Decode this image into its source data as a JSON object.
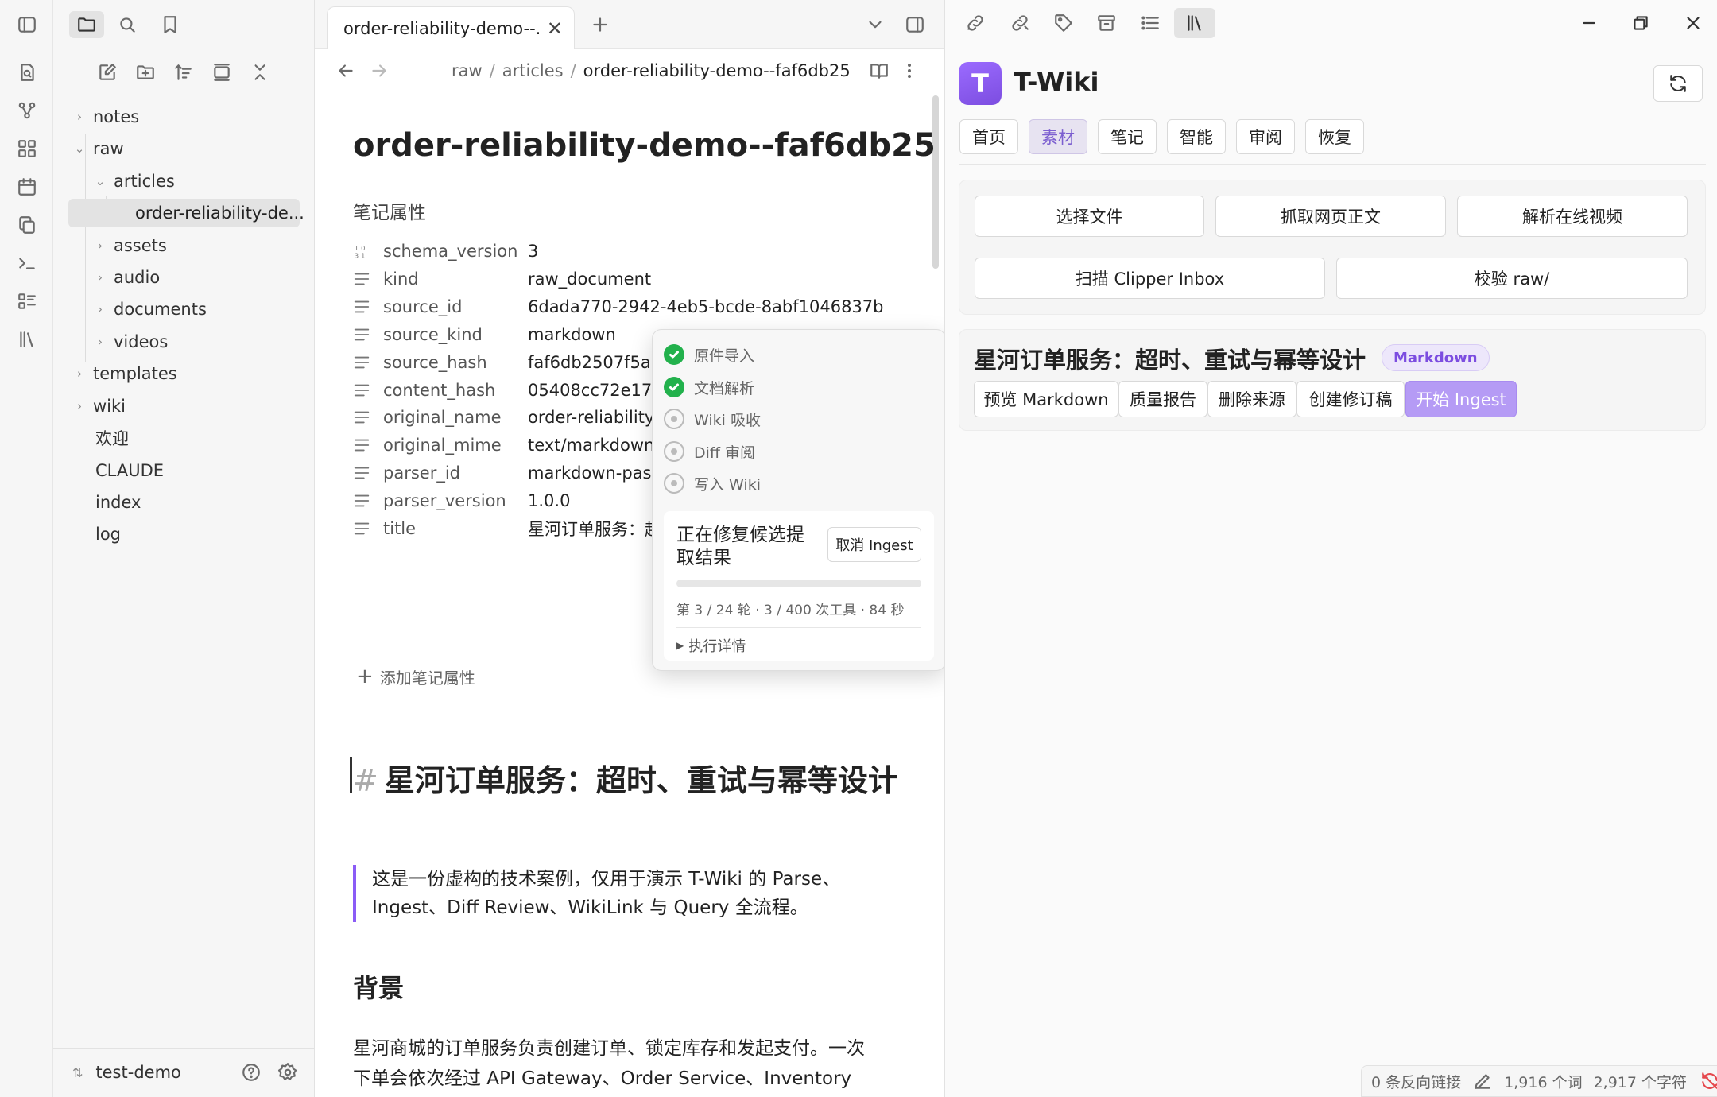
{
  "ribbon": {
    "icons": [
      "sidebar-toggle-icon",
      "search-file-icon",
      "graph-icon",
      "canvas-icon",
      "calendar-icon",
      "copy-icon",
      "terminal-icon",
      "list-icon",
      "library-icon"
    ]
  },
  "explorer": {
    "toolbar_icons": [
      "new-note-icon",
      "new-folder-icon",
      "sort-icon",
      "collapse-view-icon",
      "close-icon"
    ],
    "tree": [
      {
        "label": "notes"
      },
      {
        "label": "raw"
      },
      {
        "label": "articles"
      },
      {
        "label": "order-reliability-de..."
      },
      {
        "label": "assets"
      },
      {
        "label": "audio"
      },
      {
        "label": "documents"
      },
      {
        "label": "videos"
      },
      {
        "label": "templates"
      },
      {
        "label": "wiki"
      },
      {
        "label": "欢迎"
      },
      {
        "label": "CLAUDE"
      },
      {
        "label": "index"
      },
      {
        "label": "log"
      }
    ],
    "vault_name": "test-demo"
  },
  "editor": {
    "tab_title": "order-reliability-demo--...",
    "breadcrumb": [
      "raw",
      "/",
      "articles",
      "/",
      "order-reliability-demo--faf6db25"
    ],
    "title": "order-reliability-demo--faf6db25",
    "properties_heading": "笔记属性",
    "properties": [
      {
        "key": "schema_version",
        "value": "3",
        "icon": "number-icon"
      },
      {
        "key": "kind",
        "value": "raw_document",
        "icon": "text-icon"
      },
      {
        "key": "source_id",
        "value": "6dada770-2942-4eb5-bcde-8abf1046837b",
        "icon": "text-icon"
      },
      {
        "key": "source_kind",
        "value": "markdown",
        "icon": "text-icon"
      },
      {
        "key": "source_hash",
        "value": "faf6db2507f5a0",
        "icon": "text-icon"
      },
      {
        "key": "content_hash",
        "value": "05408cc72e175",
        "icon": "text-icon"
      },
      {
        "key": "original_name",
        "value": "order-reliability",
        "icon": "text-icon"
      },
      {
        "key": "original_mime",
        "value": "text/markdown",
        "icon": "text-icon"
      },
      {
        "key": "parser_id",
        "value": "markdown-pass",
        "icon": "text-icon"
      },
      {
        "key": "parser_version",
        "value": "1.0.0",
        "icon": "text-icon"
      },
      {
        "key": "title",
        "value": "星河订单服务：超",
        "icon": "text-icon"
      }
    ],
    "add_property": "添加笔记属性",
    "h1_mark": "#",
    "h1": "星河订单服务：超时、重试与幂等设计",
    "quote_line1": "这是一份虚构的技术案例，仅用于演示 T-Wiki 的 Parse、",
    "quote_line2": "Ingest、Diff Review、WikiLink 与 Query 全流程。",
    "h2": "背景",
    "para_line1": "星河商城的订单服务负责创建订单、锁定库存和发起支付。一次",
    "para_line2": "下单会依次经过 API Gateway、Order Service、Inventory"
  },
  "popover": {
    "steps": [
      {
        "label": "原件导入",
        "done": true
      },
      {
        "label": "文档解析",
        "done": true
      },
      {
        "label": "Wiki 吸收",
        "done": false
      },
      {
        "label": "Diff 审阅",
        "done": false
      },
      {
        "label": "写入 Wiki",
        "done": false
      }
    ],
    "status_line1": "正在修复候选提",
    "status_line2": "取结果",
    "cancel_label": "取消 Ingest",
    "progress": "第 3 / 24 轮 · 3 / 400 次工具 · 84 秒",
    "progress_fraction": 0.0,
    "details_label": "执行详情"
  },
  "panel": {
    "top_icons": [
      "link-icon",
      "unlink-icon",
      "tag-icon",
      "archive-icon",
      "outline-icon",
      "library-icon"
    ],
    "window_controls": [
      "minimize-icon",
      "restore-icon",
      "close-icon"
    ],
    "logo_letter": "T",
    "app_name": "T-Wiki",
    "nav": [
      "首页",
      "素材",
      "笔记",
      "智能",
      "审阅",
      "恢复"
    ],
    "active_nav": "素材",
    "actions_row1": [
      "选择文件",
      "抓取网页正文",
      "解析在线视频"
    ],
    "actions_row2": [
      "扫描 Clipper Inbox",
      "校验 raw/"
    ],
    "source_title": "星河订单服务：超时、重试与幂等设计",
    "source_badge": "Markdown",
    "source_actions": [
      "预览 Markdown",
      "质量报告",
      "删除来源",
      "创建修订稿"
    ],
    "ingest_label": "开始 Ingest",
    "accent": "#8b5cf6"
  },
  "statusbar": {
    "backlinks": "0 条反向链接",
    "words": "1,916 个词",
    "chars": "2,917 个字符"
  }
}
